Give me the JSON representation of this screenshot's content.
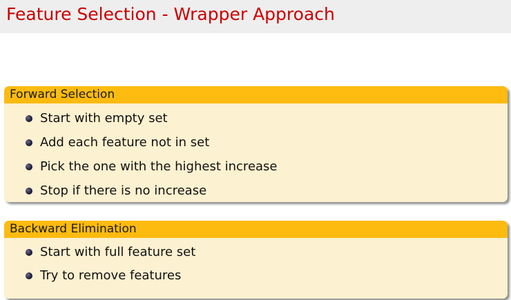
{
  "slide": {
    "title": "Feature Selection - Wrapper Approach"
  },
  "blocks": [
    {
      "header": "Forward Selection",
      "items": [
        "Start with empty set",
        "Add each feature not in set",
        "Pick the one with the highest increase",
        "Stop if there is no increase"
      ]
    },
    {
      "header": "Backward Elimination",
      "items": [
        "Start with full feature set",
        "Try to remove features"
      ]
    }
  ],
  "colors": {
    "title_text": "#cc0000",
    "title_bar": "#eeeeee",
    "block_header": "#fdbb10",
    "block_body": "#fcf1d0"
  },
  "icons": {
    "bullet": "bullet-ball-icon"
  }
}
